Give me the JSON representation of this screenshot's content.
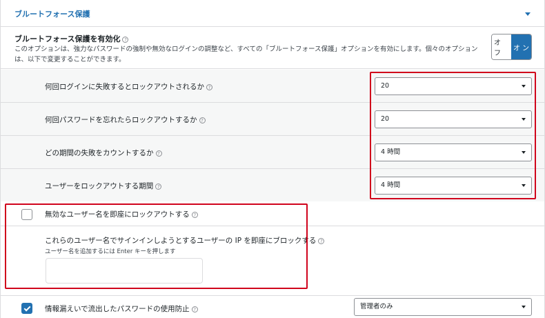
{
  "section": {
    "title": "ブルートフォース保護"
  },
  "enable": {
    "title": "ブルートフォース保護を有効化",
    "description": "このオプションは、強力なパスワードの強制や無効なログインの調整など、すべての「ブルートフォース保護」オプションを有効にします。個々のオプションは、以下で変更することができます。",
    "toggle_off": "オフ",
    "toggle_on": "オン",
    "enabled": true
  },
  "settings": [
    {
      "label": "何回ログインに失敗するとロックアウトされるか",
      "value": "20"
    },
    {
      "label": "何回パスワードを忘れたらロックアウトするか",
      "value": "20"
    },
    {
      "label": "どの期間の失敗をカウントするか",
      "value": "4 時間"
    },
    {
      "label": "ユーザーをロックアウトする期間",
      "value": "4 時間"
    }
  ],
  "lock_invalid": {
    "label": "無効なユーザー名を即座にロックアウトする",
    "checked": false
  },
  "block_usernames": {
    "label": "これらのユーザー名でサインインしようとするユーザーの IP を即座にブロックする",
    "hint": "ユーザー名を追加するには Enter キーを押します",
    "value": ""
  },
  "leaked_password": {
    "label": "情報漏えいで流出したパスワードの使用防止",
    "checked": true,
    "value": "管理者のみ"
  },
  "help_glyph": "?",
  "colors": {
    "accent": "#2271b1",
    "highlight": "#d0021b"
  }
}
